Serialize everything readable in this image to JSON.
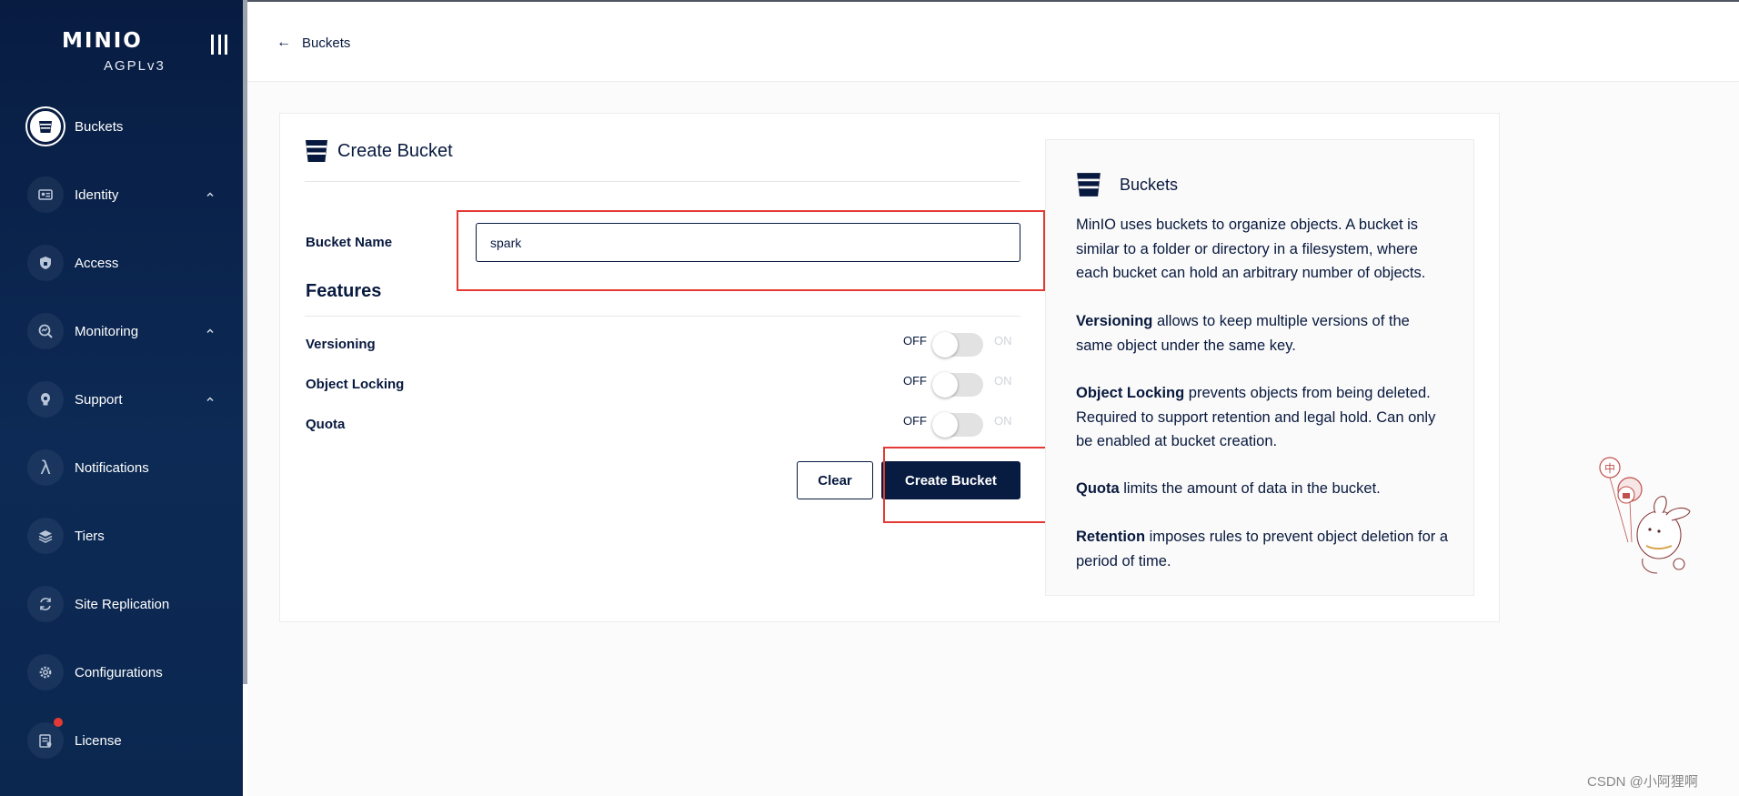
{
  "sidebar": {
    "logo": "MINIO",
    "license": "AGPLv3",
    "items": [
      {
        "label": "Buckets",
        "icon": "bucket-icon",
        "active": true
      },
      {
        "label": "Identity",
        "icon": "identity-icon",
        "expandable": true
      },
      {
        "label": "Access",
        "icon": "shield-icon"
      },
      {
        "label": "Monitoring",
        "icon": "monitoring-icon",
        "expandable": true
      },
      {
        "label": "Support",
        "icon": "support-icon",
        "expandable": true
      },
      {
        "label": "Notifications",
        "icon": "lambda-icon"
      },
      {
        "label": "Tiers",
        "icon": "tiers-icon"
      },
      {
        "label": "Site Replication",
        "icon": "replication-icon"
      },
      {
        "label": "Configurations",
        "icon": "gear-icon"
      },
      {
        "label": "License",
        "icon": "license-icon"
      }
    ]
  },
  "topbar": {
    "back_label": "Buckets"
  },
  "form": {
    "title": "Create Bucket",
    "bucket_name_label": "Bucket Name",
    "bucket_name_value": "spark",
    "features_title": "Features",
    "features": [
      {
        "label": "Versioning",
        "off": "OFF",
        "on": "ON"
      },
      {
        "label": "Object Locking",
        "off": "OFF",
        "on": "ON"
      },
      {
        "label": "Quota",
        "off": "OFF",
        "on": "ON"
      }
    ],
    "clear_label": "Clear",
    "create_label": "Create Bucket"
  },
  "help": {
    "title": "Buckets",
    "intro": "MinIO uses buckets to organize objects. A bucket is similar to a folder or directory in a filesystem, where each bucket can hold an arbitrary number of objects.",
    "versioning_term": "Versioning",
    "versioning_text": " allows to keep multiple versions of the same object under the same key.",
    "locking_term": "Object Locking",
    "locking_text": " prevents objects from being deleted. Required to support retention and legal hold. Can only be enabled at bucket creation.",
    "quota_term": "Quota",
    "quota_text": " limits the amount of data in the bucket.",
    "retention_term": "Retention",
    "retention_text": " imposes rules to prevent object deletion for a period of time."
  },
  "mascot_text": "中",
  "watermark": "CSDN @小阿狸啊",
  "colors": {
    "primary": "#081c42",
    "highlight": "#e53935",
    "text": "#07193e"
  }
}
